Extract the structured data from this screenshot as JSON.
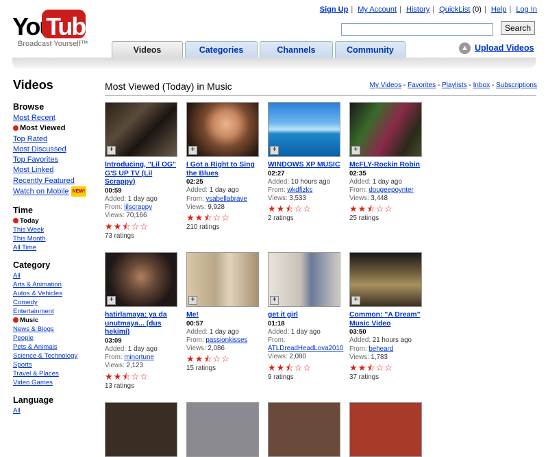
{
  "logo": {
    "text1": "You",
    "text2": "Tube",
    "tagline": "Broadcast Yourself™"
  },
  "toplinks": [
    "Sign Up",
    "My Account",
    "History",
    "QuickList",
    "(0)",
    "Help",
    "Log In"
  ],
  "search": {
    "value": "",
    "button": "Search"
  },
  "tabs": [
    "Videos",
    "Categories",
    "Channels",
    "Community"
  ],
  "upload": "Upload Videos",
  "page_title": "Videos",
  "section_title": "Most Viewed (Today) in Music",
  "mylinks": [
    "My Videos",
    "Favorites",
    "Playlists",
    "Inbox",
    "Subscriptions"
  ],
  "sidebar": {
    "browse": {
      "heading": "Browse",
      "items": [
        "Most Recent",
        "Most Viewed",
        "Top Rated",
        "Most Discussed",
        "Top Favorites",
        "Most Linked",
        "Recently Featured",
        "Watch on Mobile"
      ],
      "new_badge": "NEW!"
    },
    "time": {
      "heading": "Time",
      "items": [
        "Today",
        "This Week",
        "This Month",
        "All Time"
      ]
    },
    "category": {
      "heading": "Category",
      "items": [
        "All",
        "Arts & Animation",
        "Autos & Vehicles",
        "Comedy",
        "Entertainment",
        "Music",
        "News & Blogs",
        "People",
        "Pets & Animals",
        "Science & Technology",
        "Sports",
        "Travel & Places",
        "Video Games"
      ]
    },
    "language": {
      "heading": "Language",
      "items": [
        "All"
      ]
    }
  },
  "labels": {
    "added": "Added:",
    "from": "From:",
    "views": "Views:"
  },
  "videos": [
    {
      "title": "Introducing, \"Lil OG\" G'S UP TV (Lil Scrappy)",
      "duration": "00:59",
      "added": "1 day ago",
      "from": "lilscrappy",
      "views": "70,166",
      "rating": 2.5,
      "ratings": "73 ratings"
    },
    {
      "title": "I Got a Right to Sing the Blues",
      "duration": "02:25",
      "added": "1 day ago",
      "from": "ysabellabrave",
      "views": "9,928",
      "rating": 2.5,
      "ratings": "210 ratings"
    },
    {
      "title": "WINDOWS XP MUSIC",
      "duration": "02:27",
      "added": "10 hours ago",
      "from": "wkdfizks",
      "views": "3,533",
      "rating": 2.5,
      "ratings": "2 ratings"
    },
    {
      "title": "McFLY-Rockin Robin",
      "duration": "02:35",
      "added": "1 day ago",
      "from": "dougeepoynter",
      "views": "3,448",
      "rating": 2.5,
      "ratings": "25 ratings"
    },
    {
      "title": "hatirlamaya: ya da unutmaya... (dus hekimi)",
      "duration": "03:09",
      "added": "1 day ago",
      "from": "minortune",
      "views": "2,123",
      "rating": 2.5,
      "ratings": "13 ratings"
    },
    {
      "title": "Me!",
      "duration": "00:57",
      "added": "1 day ago",
      "from": "passionkisses",
      "views": "2,086",
      "rating": 2.5,
      "ratings": "15 ratings"
    },
    {
      "title": "get it girl",
      "duration": "01:18",
      "added": "1 day ago",
      "from": "ATLDreadHeadLova2010",
      "views": "2,080",
      "rating": 2.5,
      "ratings": "9 ratings"
    },
    {
      "title": "Common: \"A Dream\" Music Video",
      "duration": "03:50",
      "added": "21 hours ago",
      "from": "beheard",
      "views": "1,783",
      "rating": 2.5,
      "ratings": "37 ratings"
    }
  ]
}
